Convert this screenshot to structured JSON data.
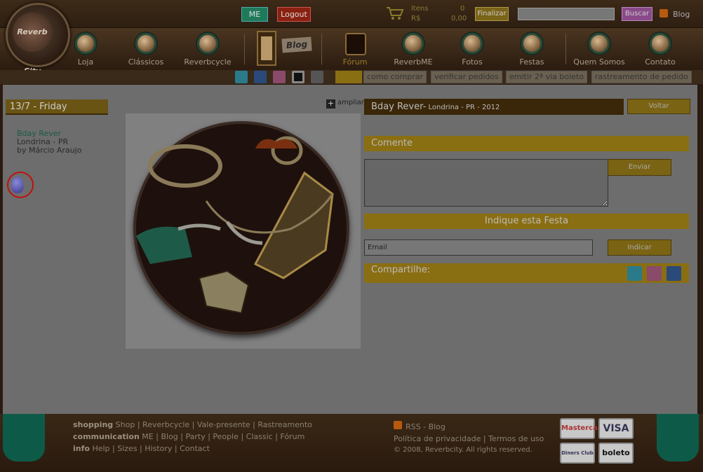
{
  "header": {
    "me": "ME",
    "logout": "Logout",
    "cart": {
      "itens_label": "itens",
      "itens_count": "0",
      "rs_label": "R$",
      "rs_value": "0,00"
    },
    "finalizar": "Finalizar",
    "search_placeholder": "",
    "buscar": "Buscar",
    "blog": "Blog",
    "logo_text": "Reverb City"
  },
  "nav": {
    "items": [
      "Loja",
      "Clássicos",
      "Reverbcycle",
      "Fórum",
      "ReverbME",
      "Fotos",
      "Festas",
      "Quem Somos",
      "Contato"
    ],
    "blog_sign": "Blog"
  },
  "subnav": {
    "links": [
      "como comprar",
      "verificar pedidos",
      "emitir 2ª via boleto",
      "rastreamento de pedido"
    ]
  },
  "event": {
    "date": "13/7 - Friday",
    "name": "Bday Rever",
    "city": "Londrina - PR",
    "by": "by Márcio Araujo"
  },
  "image": {
    "ampliar": "ampliar",
    "ampliar_icon": "+"
  },
  "detail": {
    "title": "Bday Rever-",
    "location": " Londrina - PR - 2012",
    "voltar": "Voltar",
    "comente": "Comente",
    "enviar": "Enviar",
    "indique": "Indique esta Festa",
    "email_placeholder": "Email",
    "indicar": "Indicar",
    "compartilhe": "Compartilhe:"
  },
  "footer": {
    "shopping": {
      "label": "shopping",
      "links": [
        "Shop",
        "Reverbcycle",
        "Vale-presente",
        "Rastreamento"
      ]
    },
    "communication": {
      "label": "communication",
      "links": [
        "ME",
        "Blog",
        "Party",
        "People",
        "Classic",
        "Fórum"
      ]
    },
    "info": {
      "label": "info",
      "links": [
        "Help",
        "Sizes",
        "History",
        "Contact"
      ]
    },
    "rss": "RSS - Blog",
    "privacy": "Política de privacidade",
    "terms": "Termos de uso",
    "copyright": "© 2008, Reverbcity. All rights reserved.",
    "cards": [
      "Mastercard",
      "VISA",
      "Diners Club",
      "boleto"
    ]
  }
}
